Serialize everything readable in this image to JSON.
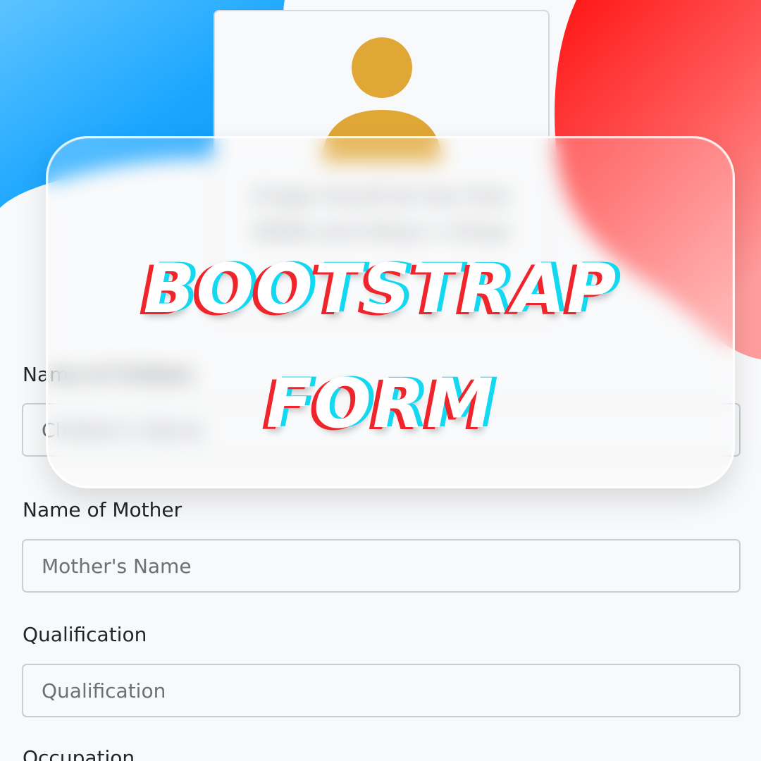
{
  "upload": {
    "hint_line1": "Image should be less than",
    "hint_line2": "500kb and 441px x 531px"
  },
  "form": {
    "children": {
      "label": "Name of Children",
      "placeholder": "Children's Name"
    },
    "mother": {
      "label": "Name of Mother",
      "placeholder": "Mother's Name"
    },
    "qualification": {
      "label": "Qualification",
      "placeholder": "Qualification"
    },
    "occupation": {
      "label": "Occupation"
    }
  },
  "overlay": {
    "title_line1": "BOOTSTRAP",
    "title_line2": "FORM"
  },
  "colors": {
    "blue_blob": "#1ea7ff",
    "red_blob": "#ff1e1e",
    "avatar": "#e0a636",
    "title_red": "#f0252c",
    "title_cyan": "#12d8f2"
  }
}
